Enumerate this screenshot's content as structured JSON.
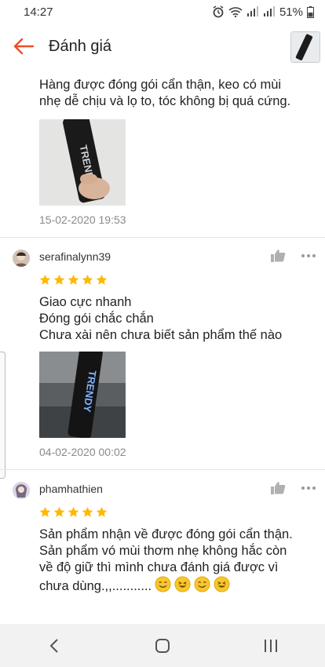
{
  "status_bar": {
    "time": "14:27",
    "battery": "51%"
  },
  "header": {
    "title": "Đánh giá"
  },
  "reviews": [
    {
      "text": "Hàng được đóng gói cẩn thận, keo có mùi\nnhẹ dễ chịu và lọ to, tóc không bị quá cứng.",
      "image_label": "TRENDY",
      "date": "15-02-2020 19:53"
    },
    {
      "username": "serafinalynn39",
      "rating": 5,
      "text": "Giao cực nhanh\nĐóng gói chắc chắn\nChưa xài nên chưa biết sản phẩm thế nào",
      "image_label": "TRENDY",
      "date": "04-02-2020 00:02"
    },
    {
      "username": "phamhathien",
      "rating": 5,
      "text": "Sản phẩm nhận về được đóng gói cẩn thận.\nSản phẩm vó mùi thơm nhẹ không hắc còn\nvề độ giữ thì mình chưa đánh giá được vì\nchưa dùng.,,...........",
      "emojis": [
        "smiling-face",
        "grinning-face",
        "smiling-face",
        "grinning-face"
      ]
    }
  ],
  "colors": {
    "accent": "#ee4d2d",
    "star": "#ffb800",
    "date": "#8a8a8a"
  }
}
